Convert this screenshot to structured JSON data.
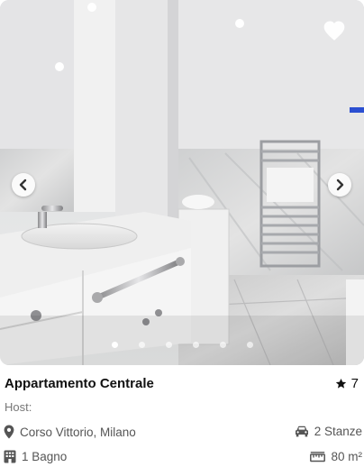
{
  "listing": {
    "title": "Appartamento Centrale",
    "rating": "7",
    "host_label": "Host:",
    "location": "Corso Vittorio, Milano",
    "rooms": "2 Stanze",
    "bathrooms": "1 Bagno",
    "area": "80 m²"
  },
  "carousel": {
    "slide_count": 6,
    "active_index": 0
  },
  "icons": {
    "favorite": "heart-icon",
    "prev": "chevron-left-icon",
    "next": "chevron-right-icon",
    "rating": "star-icon",
    "location": "map-pin-icon",
    "rooms": "car-icon",
    "bathrooms": "building-icon",
    "area": "ruler-icon"
  },
  "colors": {
    "text_primary": "#111111",
    "text_secondary": "#555555",
    "host_text": "#777777",
    "icon": "#555555"
  }
}
